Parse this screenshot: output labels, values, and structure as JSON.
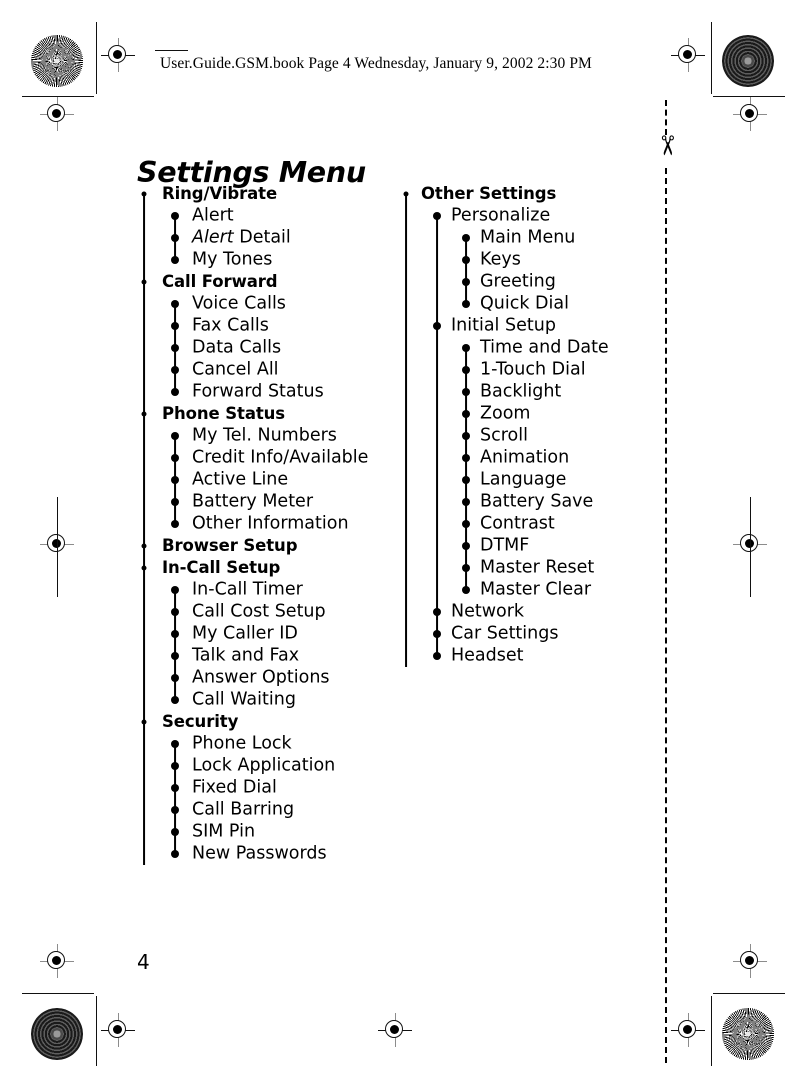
{
  "header": {
    "text": "User.Guide.GSM.book  Page 4  Wednesday, January 9, 2002  2:30 PM"
  },
  "title": "Settings Menu",
  "page_number": "4",
  "marks": {
    "scissors_glyph": "✂"
  },
  "columns": {
    "left": [
      {
        "level": 1,
        "label": "Ring/Vibrate"
      },
      {
        "level": 2,
        "label": "Alert"
      },
      {
        "level": 2,
        "label": "Alert Detail",
        "italic_prefix": "Alert",
        "rest": " Detail"
      },
      {
        "level": 2,
        "label": "My Tones"
      },
      {
        "level": 1,
        "label": "Call Forward"
      },
      {
        "level": 2,
        "label": "Voice Calls"
      },
      {
        "level": 2,
        "label": "Fax Calls"
      },
      {
        "level": 2,
        "label": "Data Calls"
      },
      {
        "level": 2,
        "label": "Cancel All"
      },
      {
        "level": 2,
        "label": "Forward Status"
      },
      {
        "level": 1,
        "label": "Phone Status"
      },
      {
        "level": 2,
        "label": "My Tel. Numbers"
      },
      {
        "level": 2,
        "label": "Credit Info/Available"
      },
      {
        "level": 2,
        "label": "Active Line"
      },
      {
        "level": 2,
        "label": "Battery Meter"
      },
      {
        "level": 2,
        "label": "Other Information"
      },
      {
        "level": 1,
        "label": "Browser Setup"
      },
      {
        "level": 1,
        "label": "In-Call Setup"
      },
      {
        "level": 2,
        "label": "In-Call Timer"
      },
      {
        "level": 2,
        "label": "Call Cost Setup"
      },
      {
        "level": 2,
        "label": "My Caller ID"
      },
      {
        "level": 2,
        "label": "Talk and Fax"
      },
      {
        "level": 2,
        "label": "Answer Options"
      },
      {
        "level": 2,
        "label": "Call Waiting"
      },
      {
        "level": 1,
        "label": "Security"
      },
      {
        "level": 2,
        "label": "Phone Lock"
      },
      {
        "level": 2,
        "label": "Lock Application"
      },
      {
        "level": 2,
        "label": "Fixed Dial"
      },
      {
        "level": 2,
        "label": "Call Barring"
      },
      {
        "level": 2,
        "label": "SIM Pin"
      },
      {
        "level": 2,
        "label": "New Passwords"
      }
    ],
    "right": [
      {
        "level": 1,
        "label": "Other Settings"
      },
      {
        "level": 2,
        "label": "Personalize"
      },
      {
        "level": 3,
        "label": "Main Menu"
      },
      {
        "level": 3,
        "label": "Keys"
      },
      {
        "level": 3,
        "label": "Greeting"
      },
      {
        "level": 3,
        "label": "Quick Dial"
      },
      {
        "level": 2,
        "label": "Initial Setup"
      },
      {
        "level": 3,
        "label": "Time and Date"
      },
      {
        "level": 3,
        "label": "1-Touch Dial"
      },
      {
        "level": 3,
        "label": "Backlight"
      },
      {
        "level": 3,
        "label": "Zoom"
      },
      {
        "level": 3,
        "label": "Scroll"
      },
      {
        "level": 3,
        "label": "Animation"
      },
      {
        "level": 3,
        "label": "Language"
      },
      {
        "level": 3,
        "label": "Battery Save"
      },
      {
        "level": 3,
        "label": "Contrast"
      },
      {
        "level": 3,
        "label": "DTMF"
      },
      {
        "level": 3,
        "label": "Master Reset"
      },
      {
        "level": 3,
        "label": "Master Clear"
      },
      {
        "level": 2,
        "label": "Network"
      },
      {
        "level": 2,
        "label": "Car Settings"
      },
      {
        "level": 2,
        "label": "Headset"
      }
    ]
  }
}
